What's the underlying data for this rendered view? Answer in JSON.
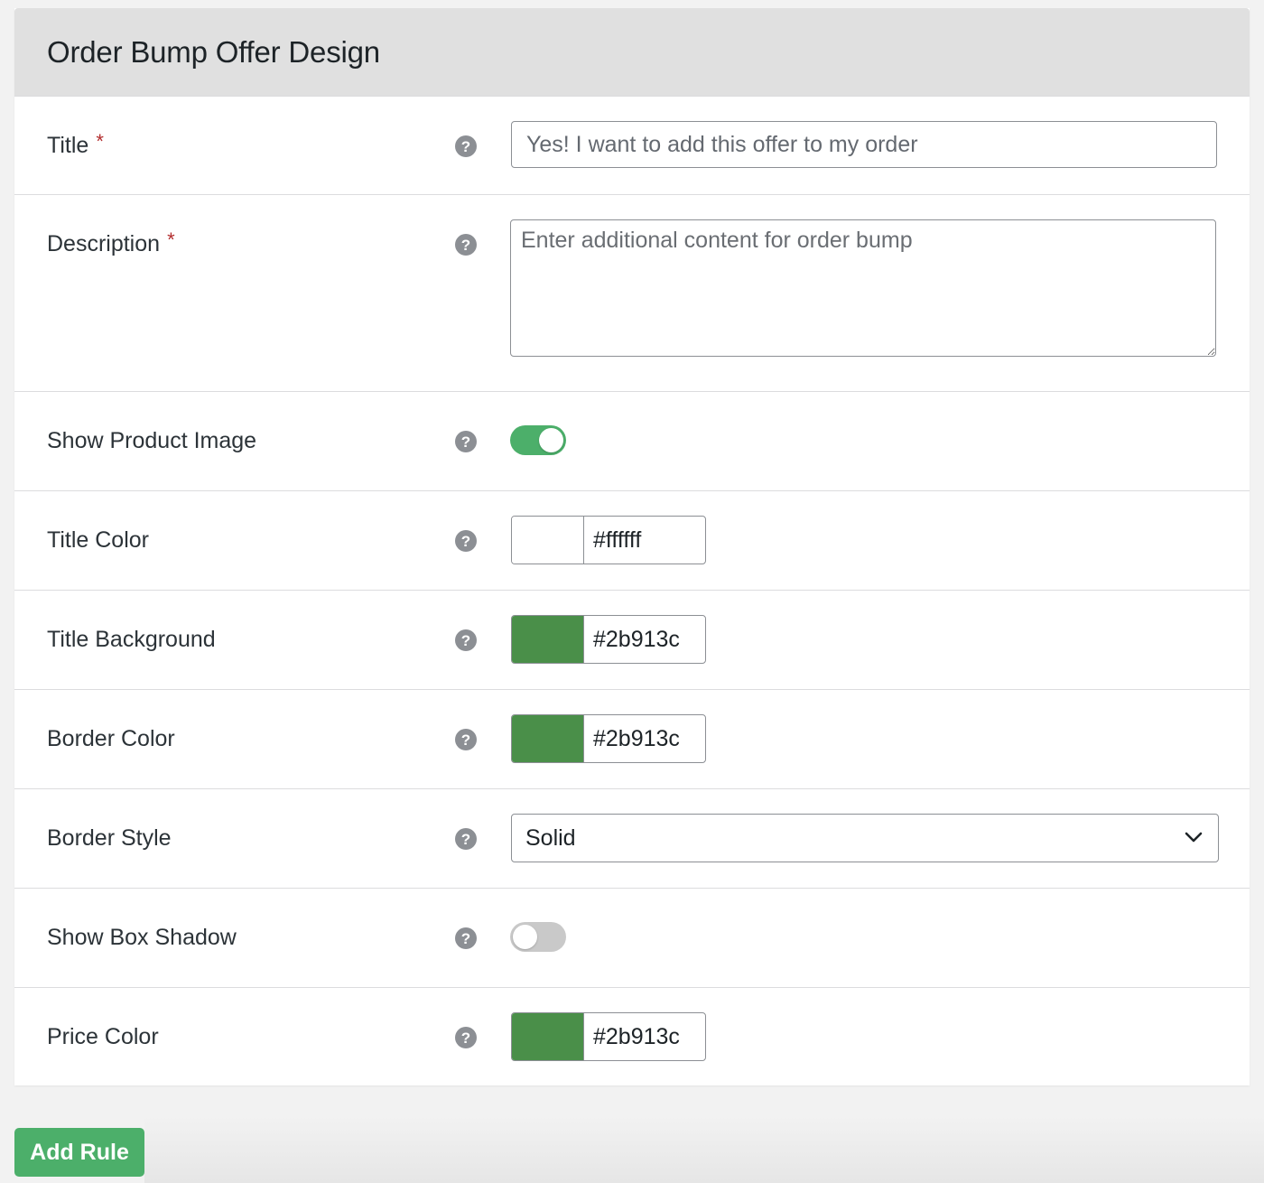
{
  "panel": {
    "title": "Order Bump Offer Design"
  },
  "fields": {
    "title": {
      "label": "Title",
      "required_mark": "*",
      "value": "Yes! I want to add this offer to my order"
    },
    "description": {
      "label": "Description",
      "required_mark": "*",
      "placeholder": "Enter additional content for order bump"
    },
    "show_product_image": {
      "label": "Show Product Image",
      "enabled": true
    },
    "title_color": {
      "label": "Title Color",
      "hex": "#ffffff",
      "display": "#ffffff"
    },
    "title_background": {
      "label": "Title Background",
      "hex": "#4a8f49",
      "display": "#2b913c"
    },
    "border_color": {
      "label": "Border Color",
      "hex": "#4a8f49",
      "display": "#2b913c"
    },
    "border_style": {
      "label": "Border Style",
      "selected": "Solid"
    },
    "show_box_shadow": {
      "label": "Show Box Shadow",
      "enabled": false
    },
    "price_color": {
      "label": "Price Color",
      "hex": "#4a8f49",
      "display": "#2b913c"
    }
  },
  "help_glyph": "?",
  "actions": {
    "add_rule_label": "Add Rule"
  },
  "colors": {
    "accent": "#4caf6a",
    "header_bg": "#e0e0e0",
    "required": "#b32d2e"
  }
}
